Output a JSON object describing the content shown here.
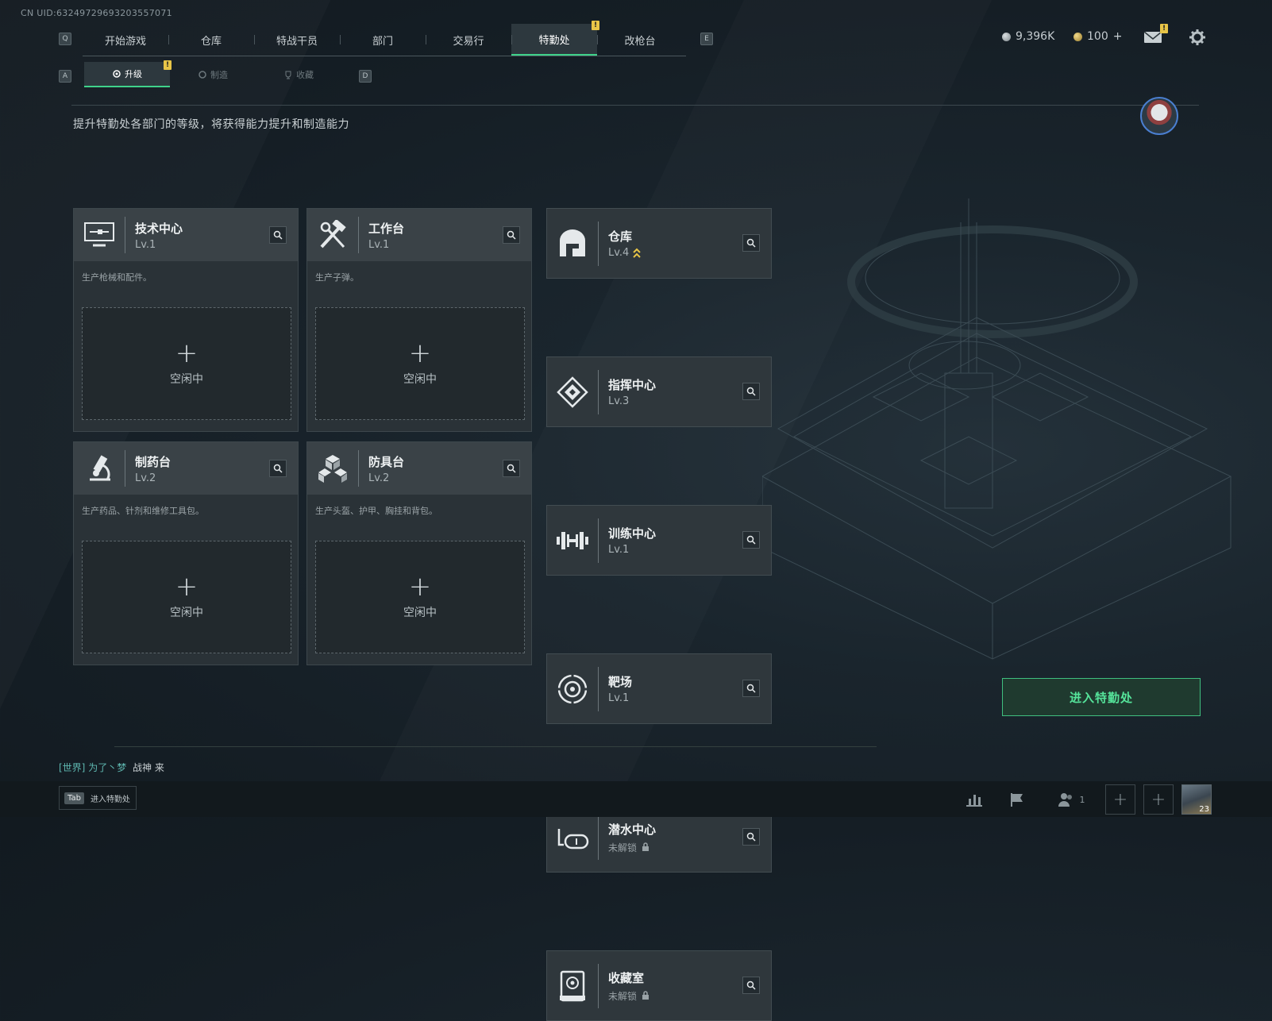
{
  "uid": "CN UID:6324972969320355707​1",
  "nav": {
    "left_key": "Q",
    "right_key": "E",
    "tabs": [
      "开始游戏",
      "仓库",
      "特战干员",
      "部门",
      "交易行",
      "特勤处",
      "改枪台"
    ],
    "active": "特勤处",
    "warn": "!"
  },
  "subnav": {
    "left_key": "A",
    "right_key": "D",
    "tabs": [
      "升级",
      "制造",
      "收藏"
    ],
    "active": "升级",
    "warn": "!"
  },
  "currency": {
    "money": "9,396K",
    "coins": "100",
    "coins_plus": "+"
  },
  "mail_warn": "!",
  "description": "提升特勤处各部门的等级，将获得能力提升和制造能力",
  "big_cards": [
    {
      "name": "技术中心",
      "level": "Lv.1",
      "note": "生产枪械和配件。",
      "slot": "空闲中",
      "plus": "+",
      "icon": "monitor-icon"
    },
    {
      "name": "工作台",
      "level": "Lv.1",
      "note": "生产子弹。",
      "slot": "空闲中",
      "plus": "+",
      "icon": "tools-icon"
    },
    {
      "name": "制药台",
      "level": "Lv.2",
      "note": "生产药品、针剂和维修工具包。",
      "slot": "空闲中",
      "plus": "+",
      "icon": "microscope-icon"
    },
    {
      "name": "防具台",
      "level": "Lv.2",
      "note": "生产头盔、护甲、胸挂和背包。",
      "slot": "空闲中",
      "plus": "+",
      "icon": "cubes-icon"
    }
  ],
  "small_cards": [
    {
      "name": "仓库",
      "level": "Lv.4",
      "icon": "vault-icon",
      "upgrade": true
    },
    {
      "name": "指挥中心",
      "level": "Lv.3",
      "icon": "command-icon"
    },
    {
      "name": "训练中心",
      "level": "Lv.1",
      "icon": "dumbbell-icon"
    },
    {
      "name": "靶场",
      "level": "Lv.1",
      "icon": "target-icon"
    },
    {
      "name": "潜水中心",
      "level": "未解锁",
      "icon": "dive-mask-icon",
      "locked": true
    },
    {
      "name": "收藏室",
      "level": "未解锁",
      "icon": "collection-icon",
      "locked": true
    }
  ],
  "enter_button": "进入特勤处",
  "chat": {
    "channel": "[世界]",
    "user": "为了丶梦",
    "text": "战神  来"
  },
  "bottom": {
    "tab_key": "Tab",
    "tab_label": "进入特勤处",
    "friends_count": "1",
    "level_badge": "23"
  },
  "colors": {
    "accent": "#3fd28a",
    "warn": "#e8c547",
    "upgrade": "#e8c547"
  }
}
